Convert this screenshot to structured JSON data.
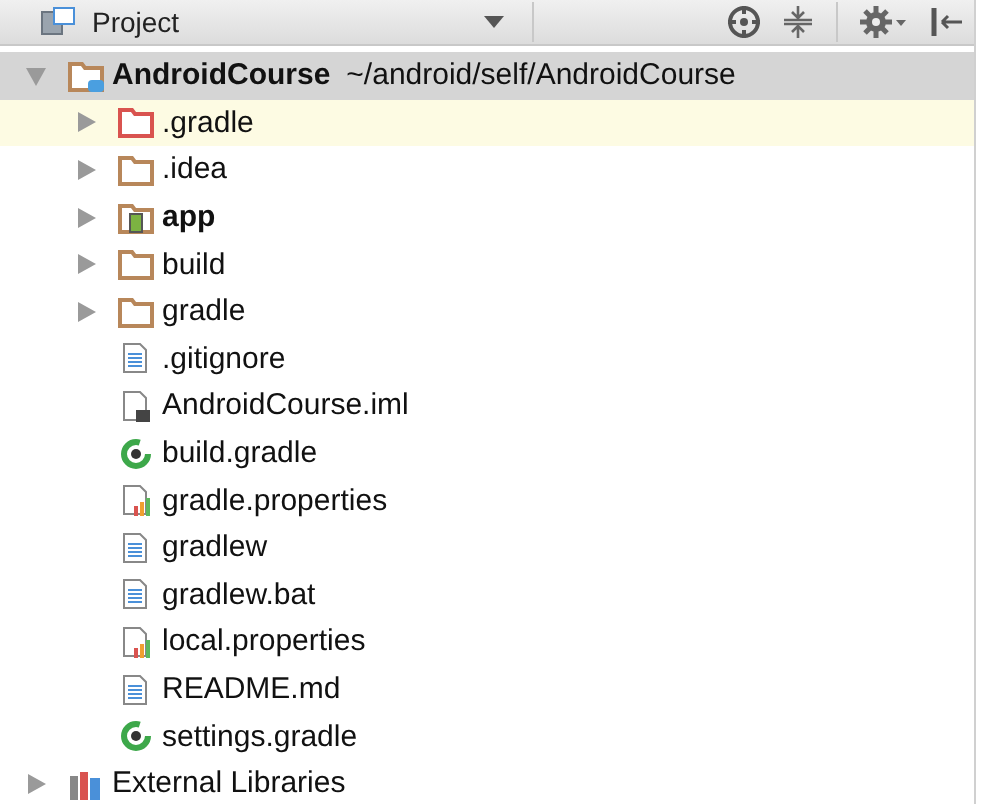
{
  "toolbar": {
    "title": "Project"
  },
  "tree": [
    {
      "label": "AndroidCourse",
      "path": "~/android/self/AndroidCourse",
      "kind": "project",
      "expanded": true,
      "selected": true,
      "highlighted": false,
      "children": [
        {
          "label": ".gradle",
          "kind": "excluded-folder",
          "expanded": false,
          "selected": false,
          "highlighted": true
        },
        {
          "label": ".idea",
          "kind": "folder",
          "expanded": false,
          "selected": false,
          "highlighted": false
        },
        {
          "label": "app",
          "kind": "module",
          "expanded": false,
          "selected": false,
          "highlighted": false
        },
        {
          "label": "build",
          "kind": "folder",
          "expanded": false,
          "selected": false,
          "highlighted": false
        },
        {
          "label": "gradle",
          "kind": "folder",
          "expanded": false,
          "selected": false,
          "highlighted": false
        },
        {
          "label": ".gitignore",
          "kind": "text",
          "selected": false,
          "highlighted": false
        },
        {
          "label": "AndroidCourse.iml",
          "kind": "iml",
          "selected": false,
          "highlighted": false
        },
        {
          "label": "build.gradle",
          "kind": "gradle",
          "selected": false,
          "highlighted": false
        },
        {
          "label": "gradle.properties",
          "kind": "properties",
          "selected": false,
          "highlighted": false
        },
        {
          "label": "gradlew",
          "kind": "text",
          "selected": false,
          "highlighted": false
        },
        {
          "label": "gradlew.bat",
          "kind": "text",
          "selected": false,
          "highlighted": false
        },
        {
          "label": "local.properties",
          "kind": "properties",
          "selected": false,
          "highlighted": false
        },
        {
          "label": "README.md",
          "kind": "text",
          "selected": false,
          "highlighted": false
        },
        {
          "label": "settings.gradle",
          "kind": "gradle",
          "selected": false,
          "highlighted": false
        }
      ]
    },
    {
      "label": "External Libraries",
      "kind": "library",
      "expanded": false,
      "selected": false,
      "highlighted": false
    }
  ]
}
